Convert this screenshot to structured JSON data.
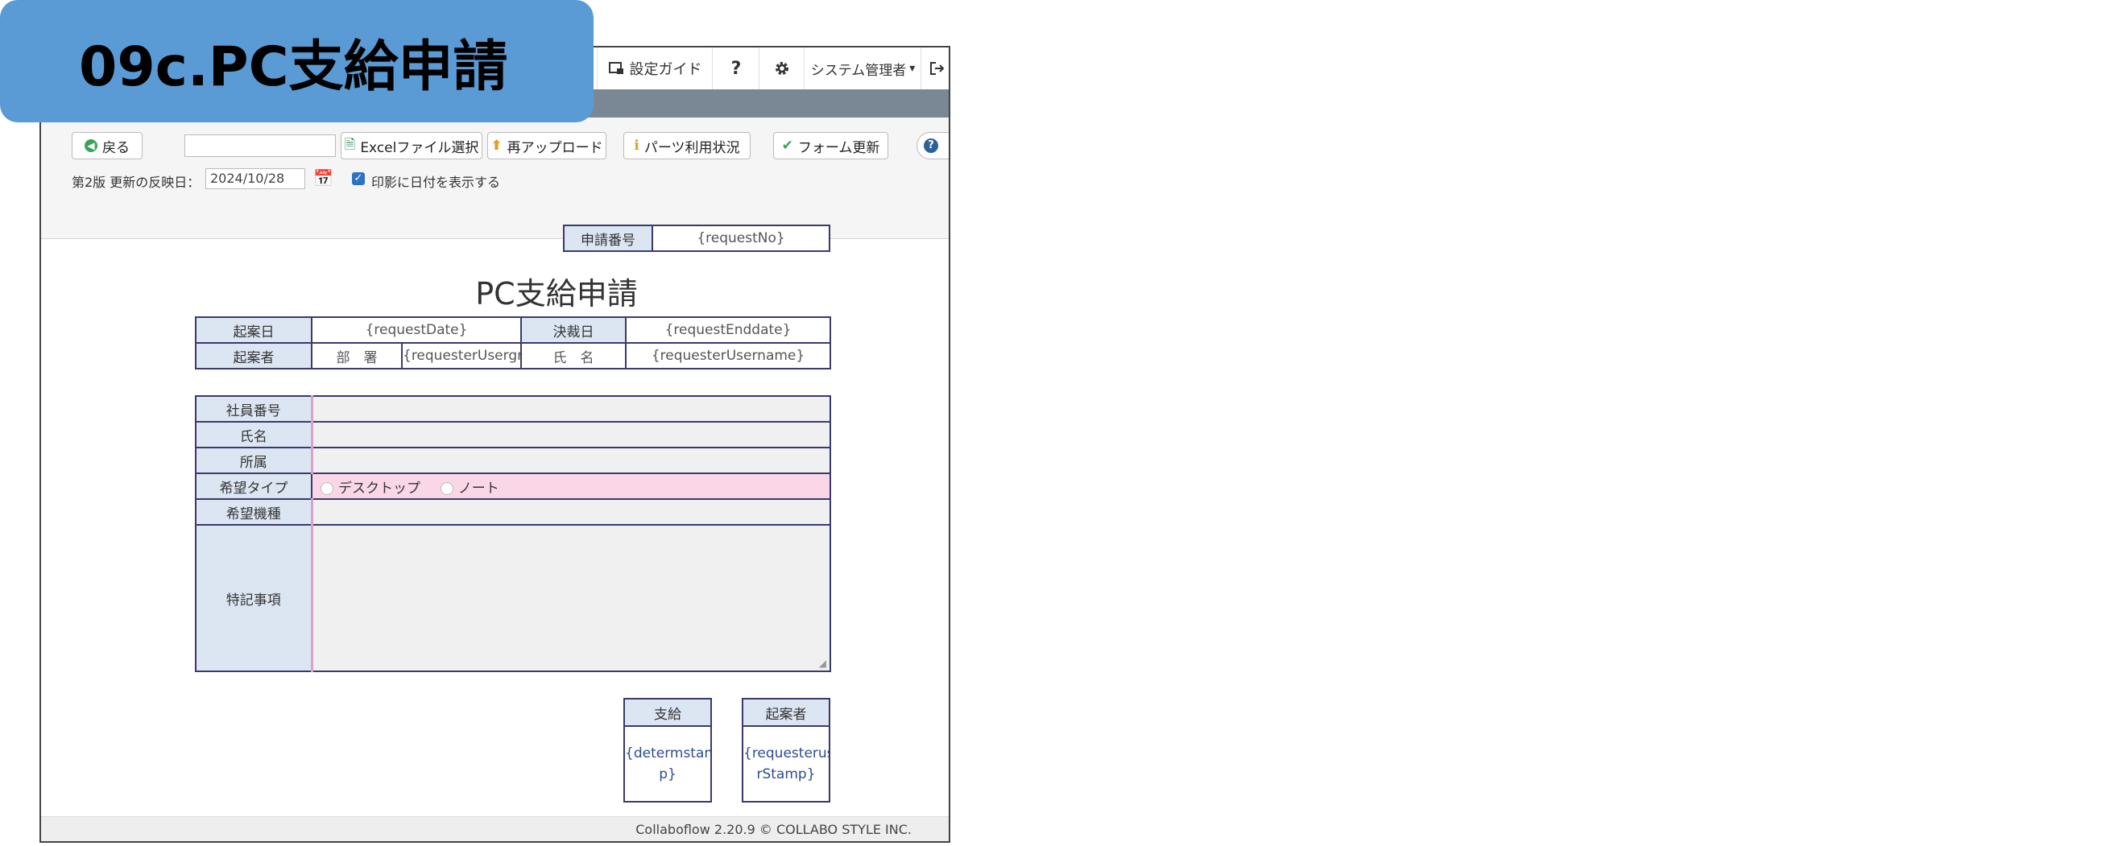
{
  "overlay": {
    "title": "09c.PC支給申請"
  },
  "nav": {
    "guide": "設定ガイド",
    "help": "?",
    "user": "システム管理者"
  },
  "toolbar": {
    "back": "戻る",
    "excel": "Excelファイル選択",
    "reupload": "再アップロード",
    "parts_usage": "パーツ利用状況",
    "form_update": "フォーム更新",
    "edition": "第2版 更新の反映日：",
    "date": "2024/10/28",
    "print_date_label": "印影に日付を表示する",
    "print_date_checked": true
  },
  "form": {
    "request_no_label": "申請番号",
    "request_no": "{requestNo}",
    "title": "PC支給申請",
    "draft_date_label": "起案日",
    "draft_date": "{requestDate}",
    "decision_date_label": "決裁日",
    "decision_date": "{requestEnddate}",
    "drafter_label": "起案者",
    "dept_label": "部　署",
    "dept": "{requesterUsergroup}",
    "name_label": "氏　名",
    "name": "{requesterUsername}",
    "fields": {
      "employee_no": "社員番号",
      "full_name": "氏名",
      "affiliation": "所属",
      "type": "希望タイプ",
      "model": "希望機種",
      "notes": "特記事項"
    },
    "type_options": [
      "デスクトップ",
      "ノート"
    ],
    "stamps": [
      {
        "label": "支給",
        "value": "{determstam p}"
      },
      {
        "label": "起案者",
        "value": "{requesteruse rStamp}"
      }
    ]
  },
  "footer": {
    "copyright": "Collaboflow 2.20.9 © COLLABO STYLE INC."
  }
}
